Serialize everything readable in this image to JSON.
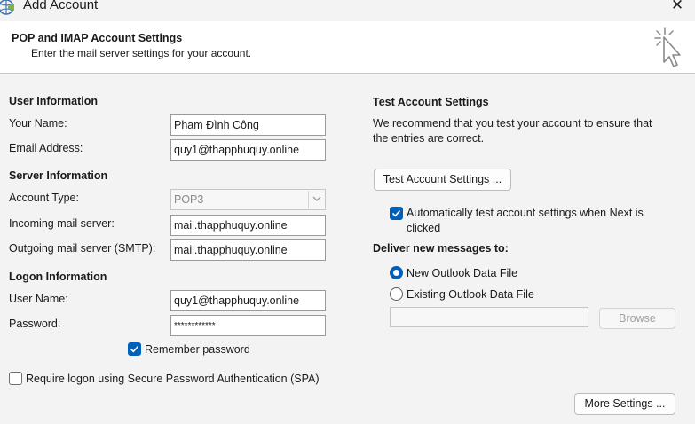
{
  "window": {
    "title": "Add Account",
    "close_label": "✕"
  },
  "header": {
    "title": "POP and IMAP Account Settings",
    "subtitle": "Enter the mail server settings for your account."
  },
  "user_info": {
    "heading": "User Information",
    "name_label": "Your Name:",
    "name_value": "Phạm Đình Công",
    "email_label": "Email Address:",
    "email_value": "quy1@thapphuquy.online"
  },
  "server_info": {
    "heading": "Server Information",
    "account_type_label": "Account Type:",
    "account_type_value": "POP3",
    "incoming_label": "Incoming mail server:",
    "incoming_value": "mail.thapphuquy.online",
    "outgoing_label": "Outgoing mail server (SMTP):",
    "outgoing_value": "mail.thapphuquy.online"
  },
  "logon_info": {
    "heading": "Logon Information",
    "username_label": "User Name:",
    "username_value": "quy1@thapphuquy.online",
    "password_label": "Password:",
    "password_value": "************",
    "remember_label": "Remember password",
    "remember_checked": true,
    "spa_label": "Require logon using Secure Password Authentication (SPA)",
    "spa_checked": false
  },
  "test_settings": {
    "heading": "Test Account Settings",
    "description_line1": "We recommend that you test your account to ensure that",
    "description_line2": "the entries are correct.",
    "test_button": "Test Account Settings ...",
    "auto_test_line1": "Automatically test account settings when Next is",
    "auto_test_line2": "clicked",
    "auto_test_checked": true
  },
  "deliver": {
    "heading": "Deliver new messages to:",
    "option_new": "New Outlook Data File",
    "option_existing": "Existing Outlook Data File",
    "selected": "new",
    "file_path": "",
    "browse_button": "Browse"
  },
  "more_settings_button": "More Settings ...",
  "icons": [
    "outlook-app-icon",
    "close-icon",
    "cursor-click-icon",
    "chevron-down-icon",
    "checkmark-icon"
  ],
  "colors": {
    "accent": "#005fb8",
    "header_bg": "#ffffff",
    "dialog_bg": "#f3f3f3"
  }
}
